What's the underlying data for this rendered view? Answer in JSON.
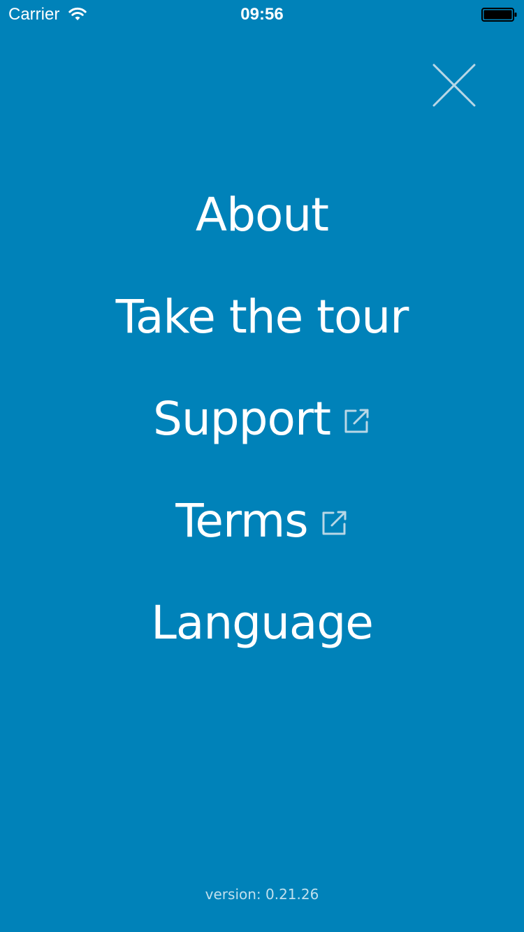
{
  "status_bar": {
    "carrier": "Carrier",
    "time": "09:56",
    "wifi_icon": "wifi-icon",
    "battery_icon": "battery-icon"
  },
  "close_button": {
    "icon": "close-icon"
  },
  "menu": {
    "items": [
      {
        "label": "About",
        "external": false
      },
      {
        "label": "Take the tour",
        "external": false
      },
      {
        "label": "Support",
        "external": true,
        "icon": "external-link-icon"
      },
      {
        "label": "Terms",
        "external": true,
        "icon": "external-link-icon"
      },
      {
        "label": "Language",
        "external": false
      }
    ]
  },
  "footer": {
    "version": "version: 0.21.26"
  },
  "colors": {
    "background": "#0082b9",
    "text": "#ffffff",
    "icon_muted": "#b8d7e6"
  }
}
